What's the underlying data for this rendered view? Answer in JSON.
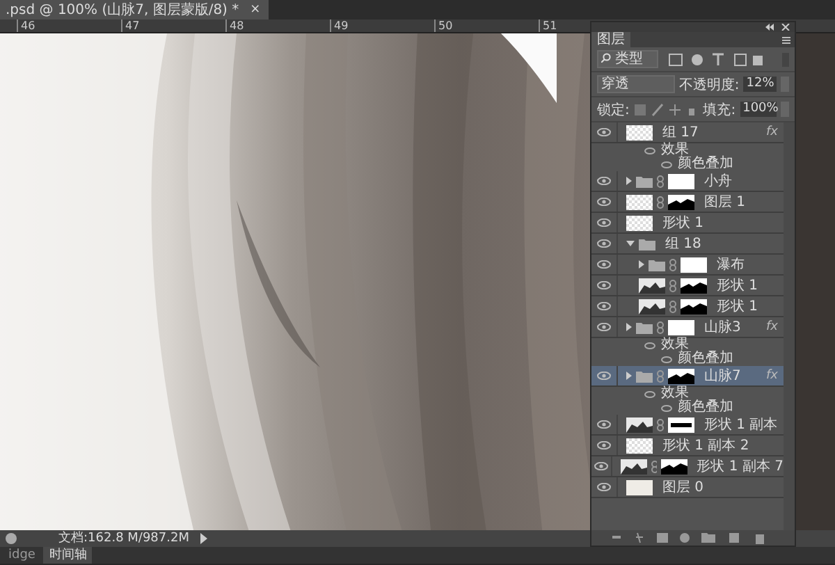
{
  "document_tab": {
    "title": ".psd @ 100% (山脉7, 图层蒙版/8) *",
    "close": "×"
  },
  "ruler": {
    "ticks": [
      "46",
      "47",
      "48",
      "49",
      "50",
      "51"
    ]
  },
  "layers_panel": {
    "title": "图层",
    "filter": "类型",
    "blend_mode": "穿透",
    "opacity_label": "不透明度:",
    "opacity": "12%",
    "lock_label": "锁定:",
    "fill_label": "填充:",
    "fill": "100%",
    "layers": [
      {
        "name": "组 17",
        "kind": "layer",
        "thumbnail": {
          "kind": "checker"
        },
        "fx": "fx",
        "selected": false,
        "visible": true,
        "effects": {
          "label": "效果",
          "items": [
            "颜色叠加"
          ]
        }
      },
      {
        "name": "小舟",
        "kind": "group",
        "expanded": false,
        "mask": {
          "kind": "white"
        },
        "selected": false,
        "visible": true
      },
      {
        "name": "图层 1",
        "kind": "layer",
        "thumbnail": {
          "kind": "checker"
        },
        "mask": {
          "kind": "shape"
        },
        "selected": false,
        "visible": true
      },
      {
        "name": "形状 1",
        "kind": "layer",
        "thumbnail": {
          "kind": "checker"
        },
        "selected": false,
        "visible": true
      },
      {
        "name": "组 18",
        "kind": "group",
        "expanded": true,
        "selected": false,
        "visible": true,
        "children": [
          {
            "name": "瀑布",
            "kind": "group",
            "expanded": false,
            "mask": {
              "kind": "white"
            },
            "selected": false,
            "visible": true
          },
          {
            "name": "形状 1",
            "kind": "layer",
            "thumbnail": {
              "kind": "shape"
            },
            "mask": {
              "kind": "shape"
            },
            "selected": false,
            "visible": true
          },
          {
            "name": "形状 1",
            "kind": "layer",
            "thumbnail": {
              "kind": "shape"
            },
            "mask": {
              "kind": "shape"
            },
            "selected": false,
            "visible": true
          }
        ]
      },
      {
        "name": "山脉3",
        "kind": "group",
        "expanded": false,
        "mask": {
          "kind": "white"
        },
        "fx": "fx",
        "selected": false,
        "visible": true,
        "effects": {
          "label": "效果",
          "items": [
            "颜色叠加"
          ]
        }
      },
      {
        "name": "山脉7",
        "kind": "group",
        "expanded": false,
        "mask": {
          "kind": "shape"
        },
        "fx": "fx",
        "selected": true,
        "visible": true,
        "effects": {
          "label": "效果",
          "items": [
            "颜色叠加"
          ]
        }
      },
      {
        "name": "形状 1 副本",
        "kind": "layer",
        "thumbnail": {
          "kind": "shape"
        },
        "mask": {
          "kind": "bar"
        },
        "selected": false,
        "visible": true
      },
      {
        "name": "形状 1 副本 2",
        "kind": "layer",
        "thumbnail": {
          "kind": "checker"
        },
        "selected": false,
        "visible": true
      },
      {
        "name": "形状 1 副本 7",
        "kind": "layer",
        "thumbnail": {
          "kind": "shape"
        },
        "mask": {
          "kind": "shape"
        },
        "selected": false,
        "visible": true
      },
      {
        "name": "图层 0",
        "kind": "layer",
        "thumbnail": {
          "kind": "cream"
        },
        "selected": false,
        "visible": true
      }
    ]
  },
  "status_bar": {
    "doc_info": "文档:162.8 M/987.2M"
  },
  "bottom_tabs": [
    {
      "label": "idge",
      "selected": false
    },
    {
      "label": "时间轴",
      "selected": true
    }
  ]
}
